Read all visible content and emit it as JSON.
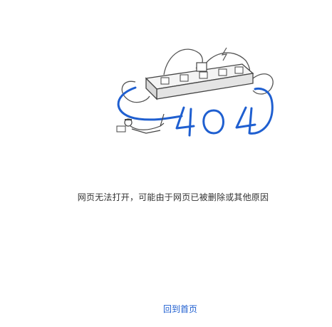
{
  "error": {
    "code_art": "404",
    "message": "网页无法打开，可能由于网页已被删除或其他原因",
    "home_link_label": "回到首页"
  },
  "colors": {
    "accent": "#1f5fd0",
    "text": "#333333",
    "line": "#555555"
  },
  "icons": {
    "illustration": "power-strip-404-illustration"
  }
}
